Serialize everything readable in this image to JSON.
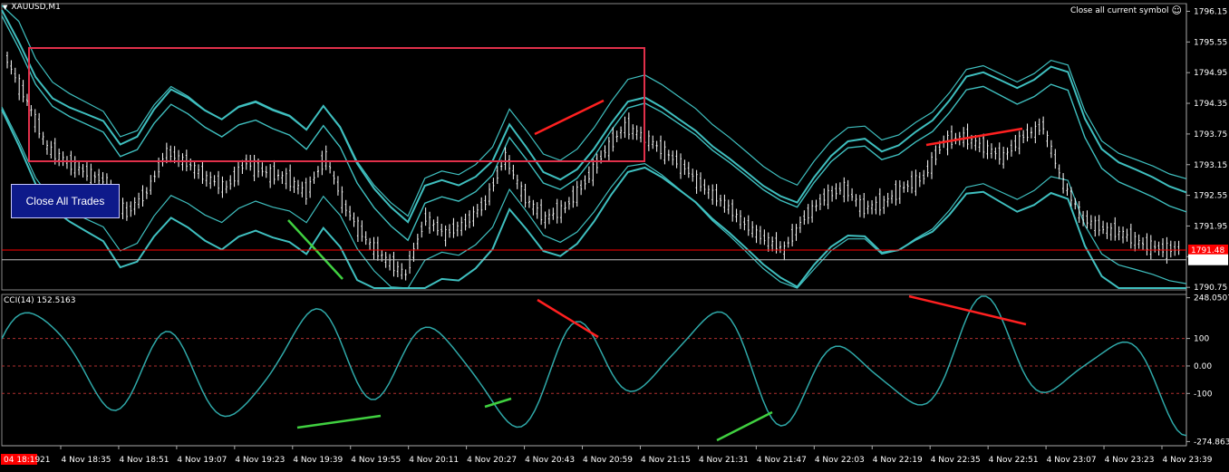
{
  "header": {
    "symbol": "XAUUSD,M1",
    "menu_glyph": "▼",
    "close_symbol_label": "Close all current symbol",
    "close_symbol_glyph": "☺"
  },
  "close_all_button": {
    "label": "Close All Trades"
  },
  "main_axis": {
    "ticks": [
      "1796.15",
      "1795.55",
      "1794.95",
      "1794.35",
      "1793.75",
      "1793.15",
      "1792.55",
      "1791.95",
      "1791.35",
      "1790.75"
    ],
    "tick_values": [
      1796.15,
      1795.55,
      1794.95,
      1794.35,
      1793.75,
      1793.15,
      1792.55,
      1791.95,
      1791.35,
      1790.75
    ],
    "ylim": [
      1790.7,
      1796.3
    ],
    "price_tag_red": {
      "label": "1791.48",
      "value": 1791.48
    },
    "price_tag_white": {
      "label": "1791.29",
      "value": 1791.29
    }
  },
  "cci": {
    "label": "CCI(14) 152.5163",
    "ticks": [
      "248.0507",
      "100",
      "0.00",
      "-100",
      "-274.8631"
    ],
    "tick_values": [
      248.0507,
      100,
      0,
      -100,
      -274.8631
    ],
    "ylim": [
      -290,
      260
    ],
    "levels": [
      100,
      0,
      -100
    ]
  },
  "time_axis": {
    "current_label": "04 18:19",
    "first_tick": "21",
    "ticks": [
      "4 Nov 18:35",
      "4 Nov 18:51",
      "4 Nov 19:07",
      "4 Nov 19:23",
      "4 Nov 19:39",
      "4 Nov 19:55",
      "4 Nov 20:11",
      "4 Nov 20:27",
      "4 Nov 20:43",
      "4 Nov 20:59",
      "4 Nov 21:15",
      "4 Nov 21:31",
      "4 Nov 21:47",
      "4 Nov 22:03",
      "4 Nov 22:19",
      "4 Nov 22:35",
      "4 Nov 22:51",
      "4 Nov 23:07",
      "4 Nov 23:23",
      "4 Nov 23:39"
    ]
  },
  "colors": {
    "background": "#000000",
    "bands": "#3fbfbf",
    "candles": "#ffffff",
    "cci_line": "#2fa9a9",
    "level_line": "#b03030",
    "divergence_red": "#ff2020",
    "divergence_green": "#40d040",
    "box": "#e0304a",
    "tag_red": "#ff0000",
    "button_bg": "#0e1a8a"
  },
  "chart_data": {
    "type": "line",
    "series": [
      {
        "values": [
          1795.2,
          1794.4,
          1793.5,
          1793.2,
          1793.0,
          1792.8,
          1792.2,
          1792.6,
          1793.4,
          1793.2,
          1792.9,
          1792.7,
          1793.2,
          1793.0,
          1792.9,
          1792.6,
          1793.3,
          1792.3,
          1791.7,
          1791.3,
          1791.0,
          1792.1,
          1791.8,
          1792.0,
          1792.4,
          1793.3,
          1792.5,
          1792.1,
          1792.3,
          1792.8,
          1793.4,
          1793.9,
          1793.7,
          1793.4,
          1793.1,
          1792.7,
          1792.4,
          1792.0,
          1791.7,
          1791.5,
          1792.1,
          1792.5,
          1792.7,
          1792.3,
          1792.4,
          1792.7,
          1792.9,
          1793.6,
          1793.7,
          1793.5,
          1793.3,
          1793.7,
          1793.9,
          1792.8,
          1792.1,
          1791.9,
          1791.8,
          1791.6,
          1791.5
        ]
      }
    ]
  }
}
